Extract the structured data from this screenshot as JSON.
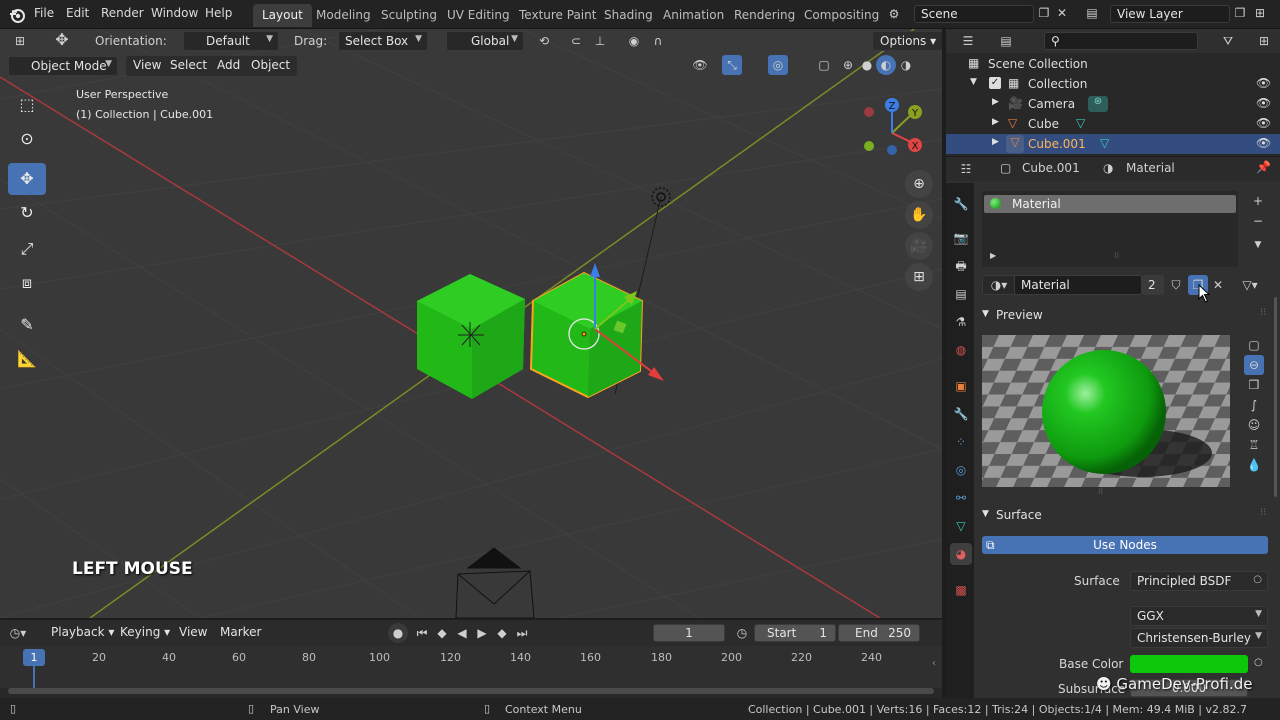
{
  "topbar": {
    "menus": [
      "File",
      "Edit",
      "Render",
      "Window",
      "Help"
    ],
    "workspaces": [
      "Layout",
      "Modeling",
      "Sculpting",
      "UV Editing",
      "Texture Paint",
      "Shading",
      "Animation",
      "Rendering",
      "Compositing"
    ],
    "active_workspace": "Layout",
    "scene": "Scene",
    "view_layer": "View Layer"
  },
  "viewport": {
    "header": {
      "orientation_label": "Orientation:",
      "orientation_value": "Default",
      "drag_label": "Drag:",
      "drag_value": "Select Box",
      "transform_value": "Global",
      "options_label": "Options",
      "mode": "Object Mode",
      "menus": [
        "View",
        "Select",
        "Add",
        "Object"
      ]
    },
    "info_line1": "User Perspective",
    "info_line2": "(1) Collection | Cube.001",
    "overlay_hint": "LEFT MOUSE",
    "gizmo": {
      "x": "X",
      "y": "Y",
      "z": "Z"
    }
  },
  "outliner": {
    "search_placeholder": "",
    "root": "Scene Collection",
    "items": [
      {
        "label": "Collection",
        "depth": 1
      },
      {
        "label": "Camera",
        "depth": 2
      },
      {
        "label": "Cube",
        "depth": 2
      },
      {
        "label": "Cube.001",
        "depth": 2,
        "selected": true
      }
    ]
  },
  "properties": {
    "breadcrumb_object": "Cube.001",
    "breadcrumb_material": "Material",
    "slot_name": "Material",
    "material_name": "Material",
    "user_count": "2",
    "preview_label": "Preview",
    "surface_label": "Surface",
    "use_nodes_label": "Use Nodes",
    "surface_field_label": "Surface",
    "surface_value": "Principled BSDF",
    "distribution": "GGX",
    "subsurface_method": "Christensen-Burley",
    "base_color_label": "Base Color",
    "subsurface_label": "Subsurface",
    "subsurface_value": "0.000"
  },
  "timeline": {
    "menus": [
      "Playback",
      "Keying",
      "View",
      "Marker"
    ],
    "current_frame": "1",
    "start_label": "Start",
    "start_value": "1",
    "end_label": "End",
    "end_value": "250",
    "frame_marker": "1",
    "ticks": [
      "20",
      "40",
      "60",
      "80",
      "100",
      "120",
      "140",
      "160",
      "180",
      "200",
      "220",
      "240"
    ]
  },
  "statusbar": {
    "pan_view": "Pan View",
    "context_menu": "Context Menu",
    "stats": "Collection | Cube.001 | Verts:16 | Faces:12 | Tris:24 | Objects:1/4 | Mem: 49.4 MiB | v2.82.7"
  },
  "watermark": "GameDev-Profi.de",
  "colors": {
    "accent": "#4772b3",
    "selection_row": "#334d80",
    "cube_green": "#22b818",
    "base_color": "#0bc80b",
    "viewport_bg": "#393939"
  }
}
